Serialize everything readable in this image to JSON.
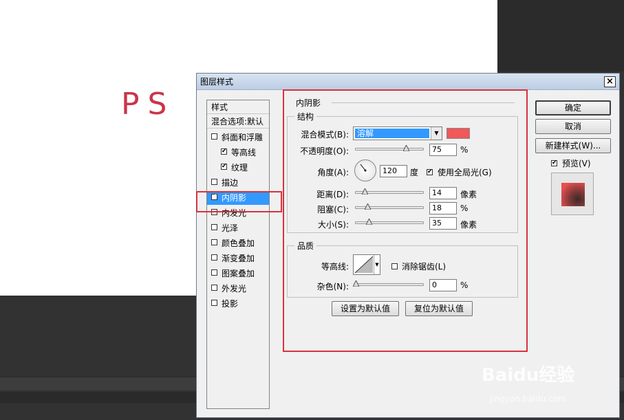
{
  "canvas": {
    "text": "PS"
  },
  "dialog": {
    "title": "图层样式",
    "close": "×",
    "styles_header": "样式",
    "blend_options": "混合选项:默认",
    "styles": [
      {
        "label": "斜面和浮雕",
        "checked": false
      },
      {
        "label": "等高线",
        "checked": true,
        "indent": true
      },
      {
        "label": "纹理",
        "checked": true,
        "indent": true
      },
      {
        "label": "描边",
        "checked": false
      },
      {
        "label": "内阴影",
        "checked": true,
        "selected": true
      },
      {
        "label": "内发光",
        "checked": false
      },
      {
        "label": "光泽",
        "checked": false
      },
      {
        "label": "颜色叠加",
        "checked": false
      },
      {
        "label": "渐变叠加",
        "checked": false
      },
      {
        "label": "图案叠加",
        "checked": false
      },
      {
        "label": "外发光",
        "checked": false
      },
      {
        "label": "投影",
        "checked": false
      }
    ],
    "section_title": "内阴影",
    "structure": {
      "legend": "结构",
      "blend_mode_label": "混合模式(B):",
      "blend_mode_value": "溶解",
      "color": "#f0585a",
      "opacity_label": "不透明度(O):",
      "opacity_value": "75",
      "opacity_unit": "%",
      "angle_label": "角度(A):",
      "angle_value": "120",
      "angle_unit": "度",
      "global_light_label": "使用全局光(G)",
      "global_light_checked": true,
      "distance_label": "距离(D):",
      "distance_value": "14",
      "distance_unit": "像素",
      "choke_label": "阻塞(C):",
      "choke_value": "18",
      "choke_unit": "%",
      "size_label": "大小(S):",
      "size_value": "35",
      "size_unit": "像素"
    },
    "quality": {
      "legend": "品质",
      "contour_label": "等高线:",
      "antialias_label": "消除锯齿(L)",
      "antialias_checked": false,
      "noise_label": "杂色(N):",
      "noise_value": "0",
      "noise_unit": "%"
    },
    "set_default": "设置为默认值",
    "reset_default": "复位为默认值",
    "ok": "确定",
    "cancel": "取消",
    "new_style": "新建样式(W)...",
    "preview_label": "预览(V)",
    "preview_checked": true
  },
  "watermark": {
    "brand": "Baidu经验",
    "url": "jingyan.baidu.com"
  }
}
